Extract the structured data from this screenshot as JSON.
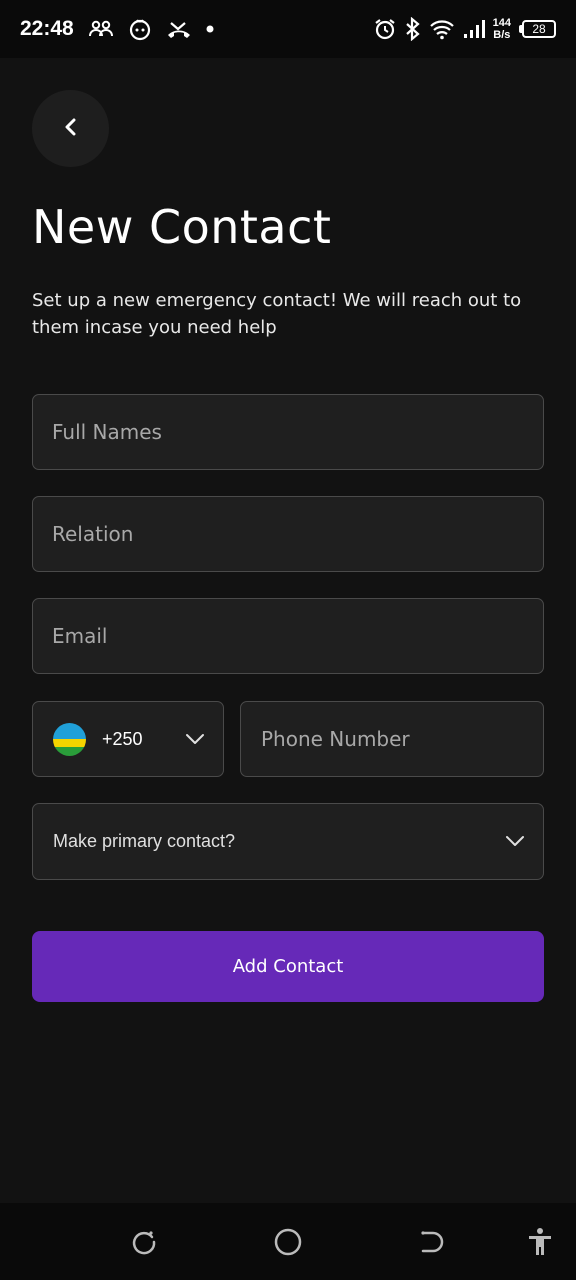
{
  "status_bar": {
    "time": "22:48",
    "left_icons": [
      "group-icon",
      "face-icon",
      "missed-call-icon",
      "dot-icon"
    ],
    "right_icons": [
      "alarm-icon",
      "bluetooth-icon",
      "wifi-icon",
      "signal-icon"
    ],
    "net_speed_value": "144",
    "net_speed_unit": "B/s",
    "battery": "28"
  },
  "header": {
    "back_icon": "chevron-left-icon",
    "title": "New Contact",
    "subtitle": "Set up a new emergency contact! We will reach out to them incase you need help"
  },
  "form": {
    "full_names": {
      "placeholder": "Full Names",
      "value": ""
    },
    "relation": {
      "placeholder": "Relation",
      "value": ""
    },
    "email": {
      "placeholder": "Email",
      "value": ""
    },
    "country_code": {
      "dial": "+250",
      "flag": "rwanda-flag-icon"
    },
    "phone": {
      "placeholder": "Phone Number",
      "value": ""
    },
    "primary_contact": {
      "label": "Make primary contact?"
    },
    "submit_label": "Add Contact"
  },
  "nav_bar": {
    "icons": [
      "recents-icon",
      "home-icon",
      "back-icon",
      "accessibility-icon"
    ]
  },
  "colors": {
    "background": "#121212",
    "field_bg": "#1f1f1f",
    "field_border": "#4a4a4a",
    "accent": "#6629b8",
    "placeholder": "#a8a8a8"
  }
}
